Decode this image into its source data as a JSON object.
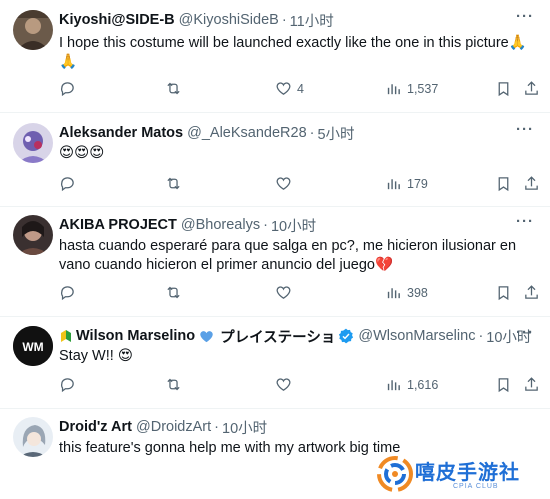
{
  "tweets": [
    {
      "name": "Kiyoshi@SIDE-B",
      "handle": "@KiyoshiSideB",
      "dot": "·",
      "time": "11小时",
      "text": "I hope this costume will be launched exactly like the one in this picture",
      "text_emoji": "🙏",
      "text_line2": "🙏",
      "replies": "",
      "retweets": "",
      "likes": "4",
      "views": "1,537"
    },
    {
      "name": "Aleksander Matos",
      "handle": "@_AleKsandeR28",
      "dot": "·",
      "time": "5小时",
      "text": "😍😍😍",
      "replies": "",
      "retweets": "",
      "likes": "",
      "views": "179"
    },
    {
      "name": "AKIBA PROJECT",
      "handle": "@Bhorealys",
      "dot": "·",
      "time": "10小时",
      "text": "hasta cuando esperaré para que salga en pc?, me hicieron ilusionar en vano cuando hicieron el primer anuncio del juego",
      "text_emoji": "💔",
      "replies": "",
      "retweets": "",
      "likes": "",
      "views": "398"
    },
    {
      "name": "Wilson Marselino",
      "name_suffix": "プレイステーショ",
      "handle": "@WlsonMarselinc",
      "dot": "·",
      "time": "10小时",
      "text": "Stay W!! ",
      "text_emoji": "😍",
      "avatar_text": "WM",
      "replies": "",
      "retweets": "",
      "likes": "",
      "views": "1,616"
    },
    {
      "name": "Droid'z Art",
      "handle": "@DroidzArt",
      "dot": "·",
      "time": "10小时",
      "text": "this feature's gonna help me with my artwork big time"
    }
  ],
  "more_label": "···",
  "watermark": {
    "title": "嘻皮手游社",
    "subtitle": "CPIA CLUB"
  },
  "colors": {
    "text": "#0f1419",
    "secondary": "#536471",
    "divider": "#eff3f4",
    "verified": "#1d9bf0"
  }
}
